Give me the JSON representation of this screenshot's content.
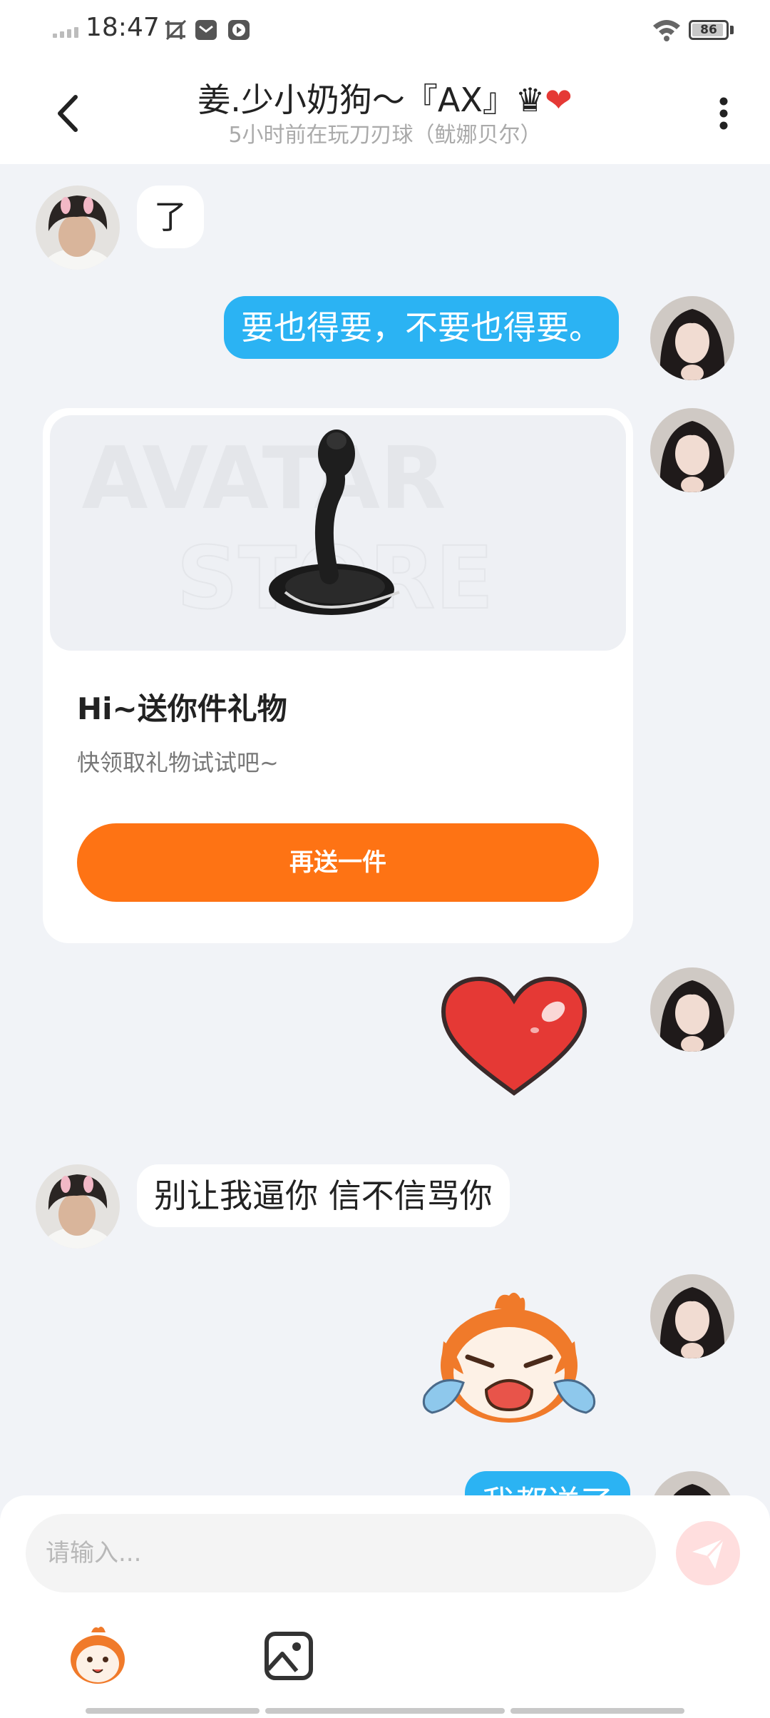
{
  "status_bar": {
    "time": "18:47",
    "battery": "86",
    "icons": [
      "signal-icon",
      "screenshot-icon",
      "mail-icon",
      "media-icon",
      "wifi-icon",
      "battery-icon"
    ]
  },
  "header": {
    "title": "姜.少小奶狗～『AX』♛",
    "title_heart": "❤",
    "subtitle": "5小时前在玩刀刃球（鱿娜贝尔）"
  },
  "messages": {
    "m1": "了",
    "m2": "要也得要，不要也得要。",
    "m3": "别让我逼你 信不信骂你",
    "m4": "我都送了"
  },
  "gift_card": {
    "watermark_line1": "AVATAR",
    "watermark_line2": "STORE",
    "title": "Hi~送你件礼物",
    "description": "快领取礼物试试吧~",
    "button": "再送一件"
  },
  "composer": {
    "placeholder": "请输入..."
  },
  "colors": {
    "outgoing_bubble": "#2bb3f3",
    "gift_button": "#fe7314",
    "chat_background": "#f1f3f7"
  }
}
